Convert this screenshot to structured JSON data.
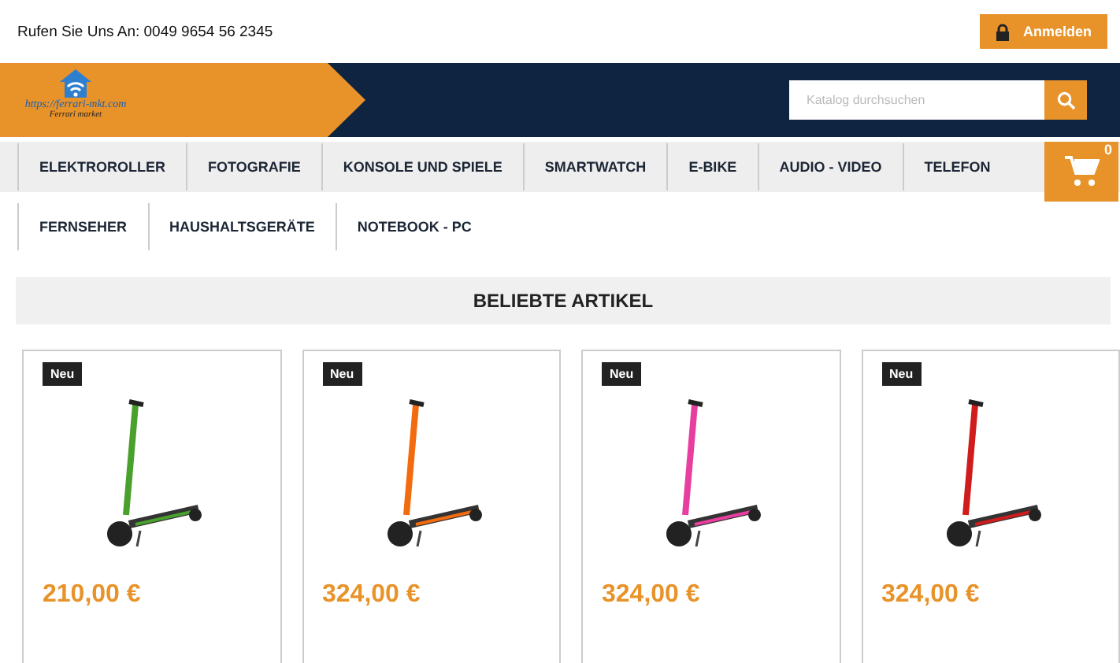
{
  "topbar": {
    "phone": "Rufen Sie Uns An: 0049 9654 56 2345",
    "login": "Anmelden"
  },
  "logo": {
    "url": "https://ferrari-mkt.com",
    "tagline": "Ferrari market"
  },
  "search": {
    "placeholder": "Katalog durchsuchen"
  },
  "cart": {
    "count": "0"
  },
  "nav": [
    [
      "ELEKTROROLLER",
      "FOTOGRAFIE",
      "KONSOLE UND SPIELE",
      "SMARTWATCH",
      "E-BIKE",
      "AUDIO - VIDEO",
      "TELEFON"
    ],
    [
      "FERNSEHER",
      "HAUSHALTSGERÄTE",
      "NOTEBOOK - PC"
    ]
  ],
  "section_title": "BELIEBTE ARTIKEL",
  "products": [
    {
      "badge": "Neu",
      "price": "210,00 €",
      "color": "#4aa02c"
    },
    {
      "badge": "Neu",
      "price": "324,00 €",
      "color": "#f26b0f"
    },
    {
      "badge": "Neu",
      "price": "324,00 €",
      "color": "#e83ea0"
    },
    {
      "badge": "Neu",
      "price": "324,00 €",
      "color": "#d01c1c"
    }
  ]
}
